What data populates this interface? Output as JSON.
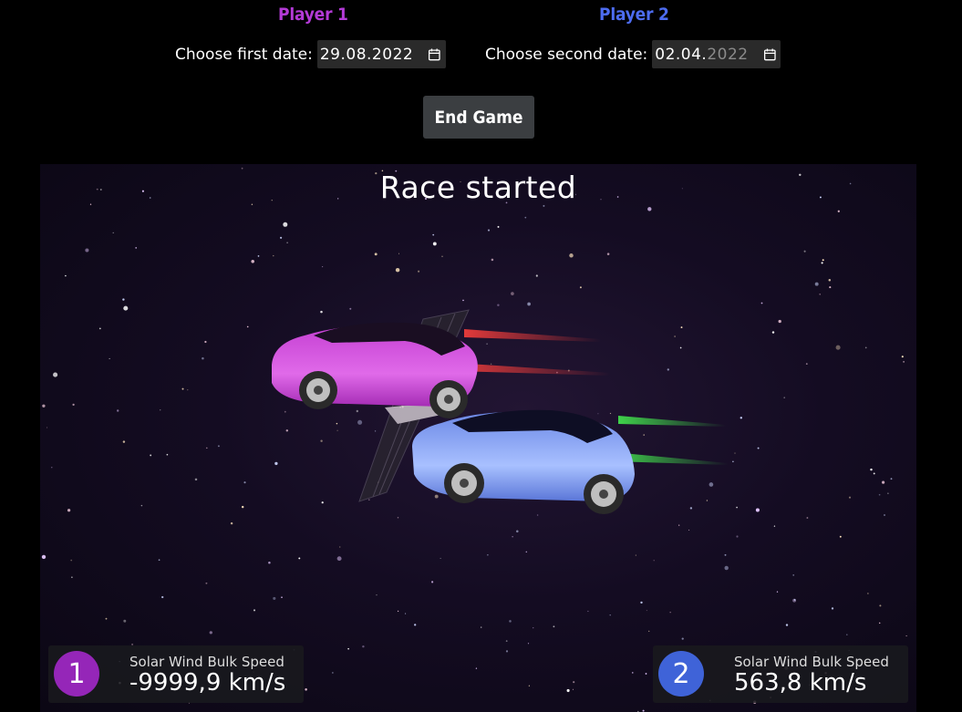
{
  "players": [
    {
      "title": "Player 1",
      "date_label": "Choose first date:",
      "date_value": "29.08.2022",
      "date_value_main": "29.08.2022",
      "date_value_muted": "",
      "color": "#b33ad6"
    },
    {
      "title": "Player 2",
      "date_label": "Choose second date:",
      "date_value": "02.04.2022",
      "date_value_main": "02.04.",
      "date_value_muted": "2022",
      "color": "#4d6cf0"
    }
  ],
  "controls": {
    "end_game_label": "End Game"
  },
  "race": {
    "status": "Race started"
  },
  "hud": [
    {
      "badge": "1",
      "label": "Solar Wind Bulk Speed",
      "value": "-9999,9 km/s",
      "badge_color": "#9526b8"
    },
    {
      "badge": "2",
      "label": "Solar Wind Bulk Speed",
      "value": "563,8 km/s",
      "badge_color": "#3f63d8"
    }
  ],
  "cars": [
    {
      "player": "1",
      "body_color": "#d34fe0",
      "trail_color": "#e23a3a"
    },
    {
      "player": "2",
      "body_color": "#7c9af2",
      "trail_color": "#3fd24a"
    }
  ],
  "icons": {
    "calendar": "calendar-icon"
  }
}
